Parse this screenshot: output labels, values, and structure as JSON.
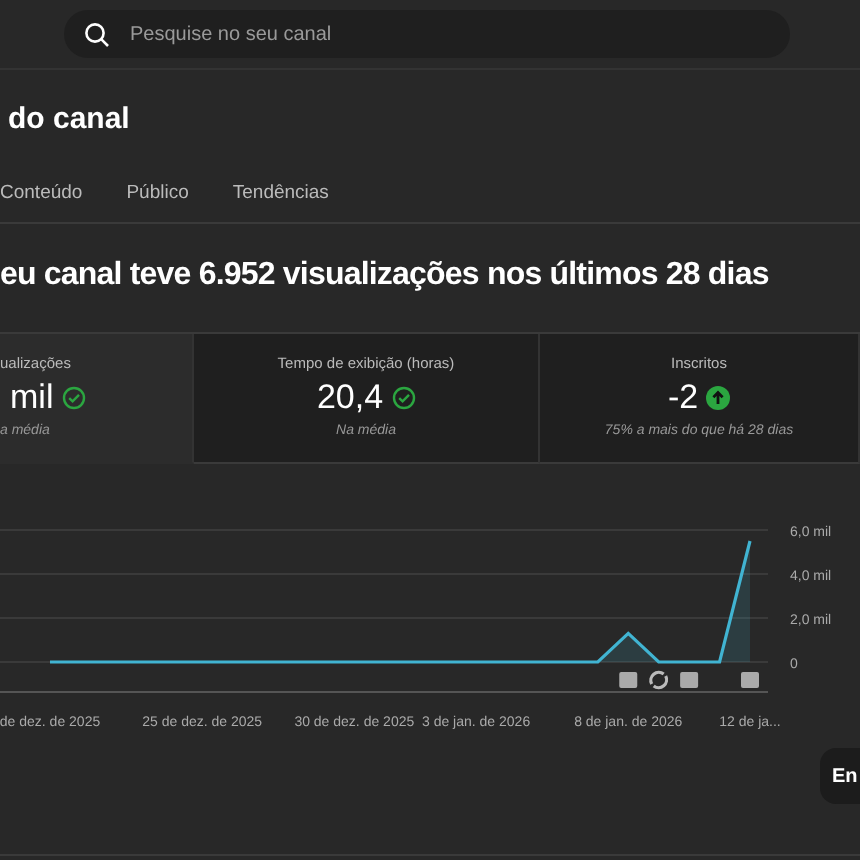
{
  "search": {
    "placeholder": "Pesquise no seu canal"
  },
  "page_title": "do canal",
  "tabs": [
    {
      "label": "Conteúdo",
      "selected": false
    },
    {
      "label": "Público",
      "selected": false
    },
    {
      "label": "Tendências",
      "selected": false
    }
  ],
  "headline": "eu canal teve 6.952 visualizações nos últimos 28 dias",
  "metrics": [
    {
      "label": "ualizações",
      "value": "mil",
      "kind": "check",
      "note": "a média",
      "selected": true
    },
    {
      "label": "Tempo de exibição (horas)",
      "value": "20,4",
      "kind": "check",
      "note": "Na média",
      "selected": false
    },
    {
      "label": "Inscritos",
      "value": "-2",
      "kind": "up",
      "note": "75% a mais do que há 28 dias",
      "selected": false
    }
  ],
  "chart": {
    "chart_data": {
      "type": "area",
      "categories": [
        "de dez. de 2025",
        null,
        null,
        null,
        null,
        "25 de dez. de 2025",
        null,
        null,
        null,
        null,
        "30 de dez. de 2025",
        null,
        null,
        null,
        "3 de jan. de 2026",
        null,
        null,
        null,
        null,
        "8 de jan. de 2026",
        null,
        null,
        null,
        "12 de ja..."
      ],
      "series": [
        {
          "color": "#41b4d2",
          "values": [
            0,
            0,
            0,
            0,
            0,
            0,
            0,
            0,
            0,
            0,
            0,
            0,
            0,
            0,
            0,
            0,
            0,
            0,
            0,
            1.3,
            0,
            0,
            0,
            5.5
          ]
        }
      ],
      "ylim": [
        0,
        6
      ],
      "yticks": [
        {
          "value": 0,
          "label": "0"
        },
        {
          "value": 2,
          "label": "2,0 mil"
        },
        {
          "value": 4,
          "label": "4,0 mil"
        },
        {
          "value": 6,
          "label": "6,0 mil"
        }
      ]
    },
    "markers": [
      {
        "kind": "video"
      },
      {
        "kind": "sync"
      },
      {
        "kind": "video"
      },
      {
        "kind": "video"
      }
    ]
  },
  "floating_button": "En"
}
